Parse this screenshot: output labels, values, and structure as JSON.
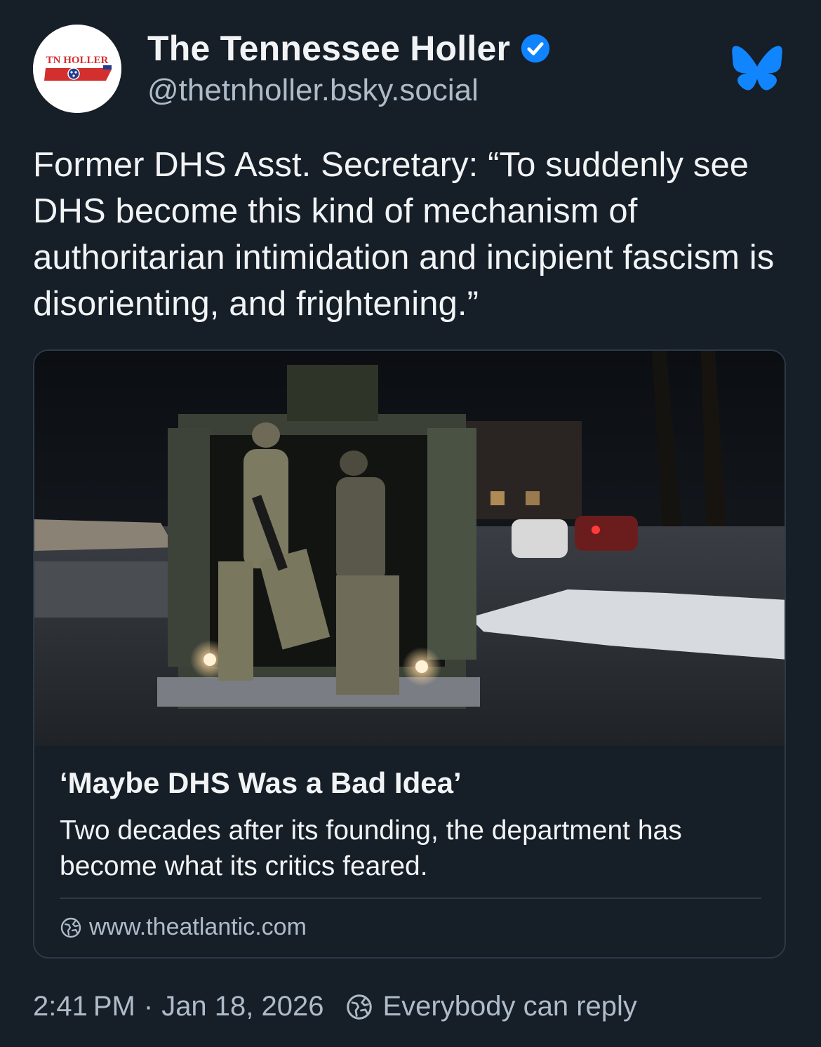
{
  "author": {
    "display_name": "The Tennessee Holler",
    "handle": "@thetnholler.bsky.social",
    "avatar_text": "TN HOLLER",
    "verified": true
  },
  "post": {
    "text": "Former DHS Asst. Secretary: “To suddenly see DHS become this kind of mechanism of authoritarian intimidation and incipient fascism is disorienting, and frightening.”"
  },
  "embed": {
    "title": "‘Maybe DHS Was a Bad Idea’",
    "description": "Two decades after its founding, the department has become what its critics feared.",
    "domain": "www.theatlantic.com"
  },
  "footer": {
    "time": "2:41 PM",
    "separator": "·",
    "date": "Jan 18, 2026",
    "reply_setting": "Everybody can reply"
  },
  "colors": {
    "background": "#161e27",
    "text": "#f1f3f5",
    "muted": "#aebbc9",
    "border": "#2e3947",
    "verified_blue": "#1083fe",
    "bluesky_blue": "#1185fe",
    "avatar_red": "#d32f2f"
  },
  "icons": {
    "verified": "verified-badge-icon",
    "bluesky": "bluesky-butterfly-icon",
    "link": "globe-icon",
    "reply": "globe-icon"
  }
}
